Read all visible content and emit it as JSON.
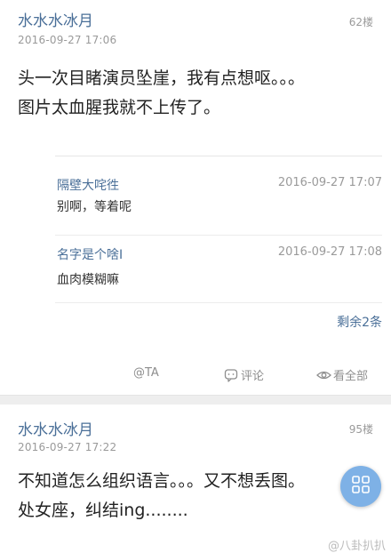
{
  "post1": {
    "author": "水水水冰月",
    "date": "2016-09-27 17:06",
    "floor": "62楼",
    "content_line1": "头一次目睹演员坠崖，我有点想呕。。。",
    "content_line2": "图片太血腥我就不上传了。",
    "replies": [
      {
        "name": "隔壁大咤徃",
        "time": "2016-09-27 17:07",
        "text": "别啊，等着呢"
      },
      {
        "name": "名字是个啥I",
        "time": "2016-09-27 17:08",
        "text": "血肉模糊嘛"
      }
    ],
    "remaining": "剩余2条",
    "actions": {
      "at": "@TA",
      "comment": "评论",
      "view_all": "看全部"
    }
  },
  "post2": {
    "author": "水水水冰月",
    "date": "2016-09-27 17:22",
    "floor": "95楼",
    "content_line1": "不知道怎么组织语言。。。又不想丢图。",
    "content_line2": "处女座，纠结ing........"
  },
  "watermark": "@八卦扒扒",
  "colors": {
    "link_blue": "#4a6f98",
    "fab_blue": "#7eb1e6",
    "divider": "#eeeeee"
  },
  "icons": {
    "comment": "comment-bubble-icon",
    "view_all": "eye-icon",
    "fab": "grid-icon"
  }
}
